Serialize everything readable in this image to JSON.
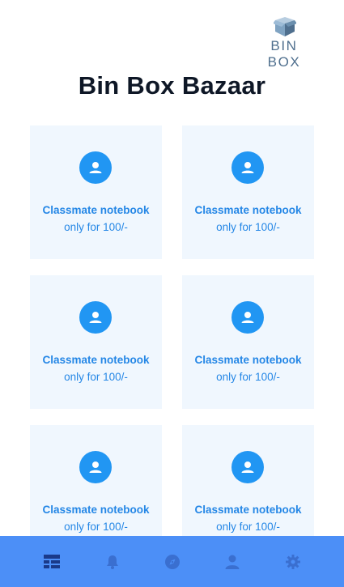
{
  "logo": {
    "text": "BIN BOX",
    "icon": "open-box-icon"
  },
  "page": {
    "title": "Bin Box Bazaar"
  },
  "products": [
    {
      "name": "Classmate notebook",
      "price": "only for 100/-",
      "icon": "user-icon"
    },
    {
      "name": "Classmate notebook",
      "price": "only for 100/-",
      "icon": "user-icon"
    },
    {
      "name": "Classmate notebook",
      "price": "only for 100/-",
      "icon": "user-icon"
    },
    {
      "name": "Classmate notebook",
      "price": "only for 100/-",
      "icon": "user-icon"
    },
    {
      "name": "Classmate notebook",
      "price": "only for 100/-",
      "icon": "user-icon"
    },
    {
      "name": "Classmate notebook",
      "price": "only for 100/-",
      "icon": "user-icon"
    }
  ],
  "bottom_nav": {
    "active": "feed",
    "items": [
      {
        "id": "feed",
        "icon": "list-view-icon"
      },
      {
        "id": "notifications",
        "icon": "bell-icon"
      },
      {
        "id": "explore",
        "icon": "compass-icon"
      },
      {
        "id": "profile",
        "icon": "user-icon"
      },
      {
        "id": "settings",
        "icon": "gear-icon"
      }
    ]
  },
  "colors": {
    "accent": "#2196f3",
    "card_background": "#f0f7fe",
    "nav_background": "#4c8ff7",
    "nav_active": "#1a3a8a",
    "nav_inactive": "#3a6fd0",
    "title": "#0e1726"
  }
}
